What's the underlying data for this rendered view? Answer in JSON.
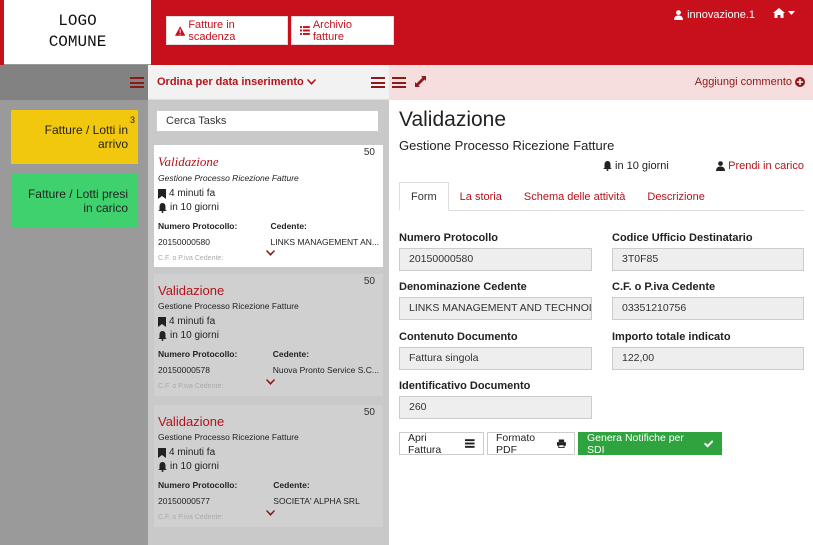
{
  "logo": {
    "line1": "LOGO",
    "line2": "COMUNE"
  },
  "header": {
    "btn_scadenza": "Fatture in scadenza",
    "btn_archivio": "Archivio fatture",
    "user": "innovazione.1"
  },
  "sidebar": {
    "arrivo_label": "Fatture / Lotti in arrivo",
    "arrivo_count": "3",
    "carico_label": "Fatture / Lotti presi in carico"
  },
  "tasklist": {
    "sort_label": "Ordina per data inserimento",
    "search_placeholder": "Cerca Tasks",
    "tasks": [
      {
        "title": "Validazione",
        "process": "Gestione Processo Ricezione Fatture",
        "num": "50",
        "age": "4 minuti fa",
        "due": "in 10 giorni",
        "proto_label": "Numero Protocollo:",
        "proto": "20150000580",
        "cedente_label": "Cedente:",
        "cedente": "LINKS MANAGEMENT AN...",
        "cf_label": "C.F. o P.iva Cedente:"
      },
      {
        "title": "Validazione",
        "process": "Gestione Processo Ricezione Fatture",
        "num": "50",
        "age": "4 minuti fa",
        "due": "in 10 giorni",
        "proto_label": "Numero Protocollo:",
        "proto": "20150000578",
        "cedente_label": "Cedente:",
        "cedente": "Nuova Pronto Service S.C...",
        "cf_label": "C.F. o P.iva Cedente:"
      },
      {
        "title": "Validazione",
        "process": "Gestione Processo Ricezione Fatture",
        "num": "50",
        "age": "4 minuti fa",
        "due": "in 10 giorni",
        "proto_label": "Numero Protocollo:",
        "proto": "20150000577",
        "cedente_label": "Cedente:",
        "cedente": "SOCIETA' ALPHA SRL",
        "cf_label": "C.F. o P.iva Cedente:"
      }
    ]
  },
  "detail": {
    "add_comment": "Aggiungi commento",
    "title": "Validazione",
    "subtitle": "Gestione Processo Ricezione Fatture",
    "due": "in 10 giorni",
    "take": "Prendi in carico",
    "tabs": [
      "Form",
      "La storia",
      "Schema delle attività",
      "Descrizione"
    ],
    "fields": {
      "numero_protocollo": {
        "label": "Numero Protocollo",
        "value": "20150000580"
      },
      "codice_ufficio": {
        "label": "Codice Ufficio Destinatario",
        "value": "3T0F85"
      },
      "denominazione": {
        "label": "Denominazione Cedente",
        "value": "LINKS MANAGEMENT AND TECHNOLOGY"
      },
      "cf_piva": {
        "label": "C.F. o P.iva Cedente",
        "value": "03351210756"
      },
      "contenuto": {
        "label": "Contenuto Documento",
        "value": "Fattura singola"
      },
      "importo": {
        "label": "Importo totale indicato",
        "value": "122,00"
      },
      "identificativo": {
        "label": "Identificativo Documento",
        "value": "260"
      }
    },
    "btn_apri": "Apri Fattura",
    "btn_pdf": "Formato PDF",
    "btn_genera": "Genera Notifiche per SDI"
  },
  "colors": {
    "brand_red": "#c8101d",
    "accent_red": "#b5121b",
    "yellow": "#f2c80e",
    "green": "#3fd16d",
    "button_green": "#2fa43e"
  }
}
